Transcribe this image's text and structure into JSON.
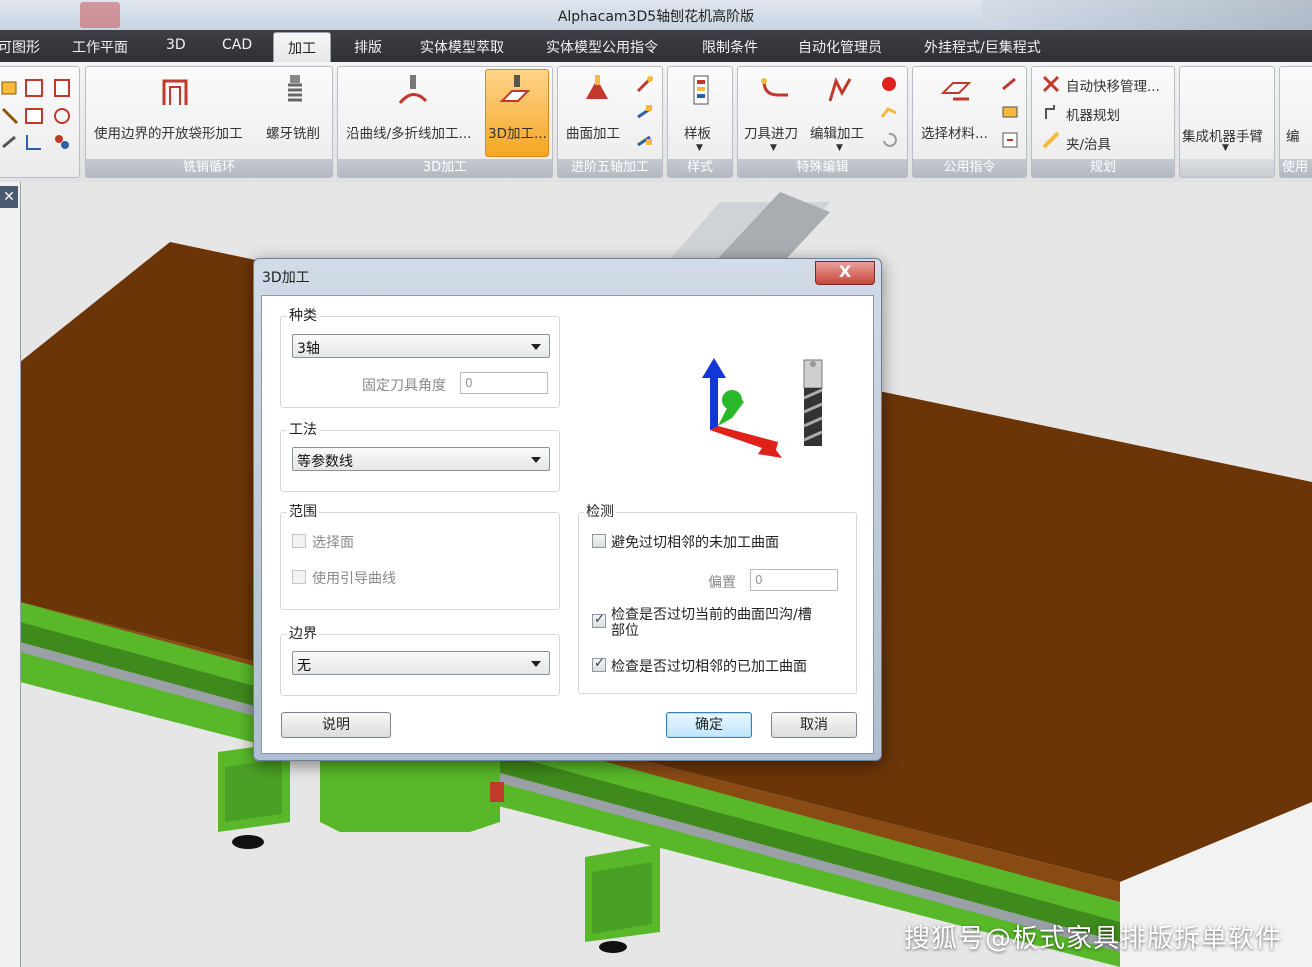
{
  "window": {
    "title": "Alphacam3D5轴刨花机高阶版"
  },
  "menu": {
    "tabs": [
      "可图形",
      "工作平面",
      "3D",
      "CAD",
      "加工",
      "排版",
      "实体模型萃取",
      "实体模型公用指令",
      "限制条件",
      "自动化管理员",
      "外挂程式/巨集程式"
    ],
    "active": "加工"
  },
  "ribbon": {
    "groups": [
      {
        "caption": "铣销循环",
        "buttons": [
          "使用边界的开放袋形加工",
          "螺牙铣削"
        ]
      },
      {
        "caption": "3D加工",
        "buttons": [
          "沿曲线/多折线加工...",
          "3D加工..."
        ]
      },
      {
        "caption": "进阶五轴加工",
        "buttons": [
          "曲面加工"
        ]
      },
      {
        "caption": "样式",
        "buttons": [
          "样板"
        ]
      },
      {
        "caption": "特殊编辑",
        "buttons": [
          "刀具进刀",
          "编辑加工"
        ]
      },
      {
        "caption": "公用指令",
        "buttons": [
          "选择材料..."
        ]
      },
      {
        "caption": "规划",
        "buttons": [
          "自动快移管理...",
          "机器规划",
          "夹/治具"
        ]
      },
      {
        "caption": "",
        "buttons": [
          "集成机器手臂"
        ]
      },
      {
        "caption": "使用",
        "buttons": [
          "编"
        ]
      }
    ]
  },
  "dialog": {
    "title": "3D加工",
    "close": "X",
    "type_group": {
      "legend": "种类",
      "value": "3轴",
      "angle_label": "固定刀具角度",
      "angle_value": "0"
    },
    "method_group": {
      "legend": "工法",
      "value": "等参数线"
    },
    "range_group": {
      "legend": "范围",
      "select_face": "选择面",
      "use_guide": "使用引导曲线"
    },
    "boundary_group": {
      "legend": "边界",
      "value": "无"
    },
    "check_group": {
      "legend": "检测",
      "avoid_label": "避免过切相邻的未加工曲面",
      "offset_label": "偏置",
      "offset_value": "0",
      "check_current_1": "检查是否过切当前的曲面凹沟/槽",
      "check_current_2": "部位",
      "check_adjacent": "检查是否过切相邻的已加工曲面"
    },
    "buttons": {
      "help": "说明",
      "ok": "确定",
      "cancel": "取消"
    }
  },
  "watermark": "搜狐号@板式家具排版拆单软件",
  "colors": {
    "board": "#6b3508",
    "machine_green": "#58b82a",
    "accent_orange": "#f5a623"
  }
}
